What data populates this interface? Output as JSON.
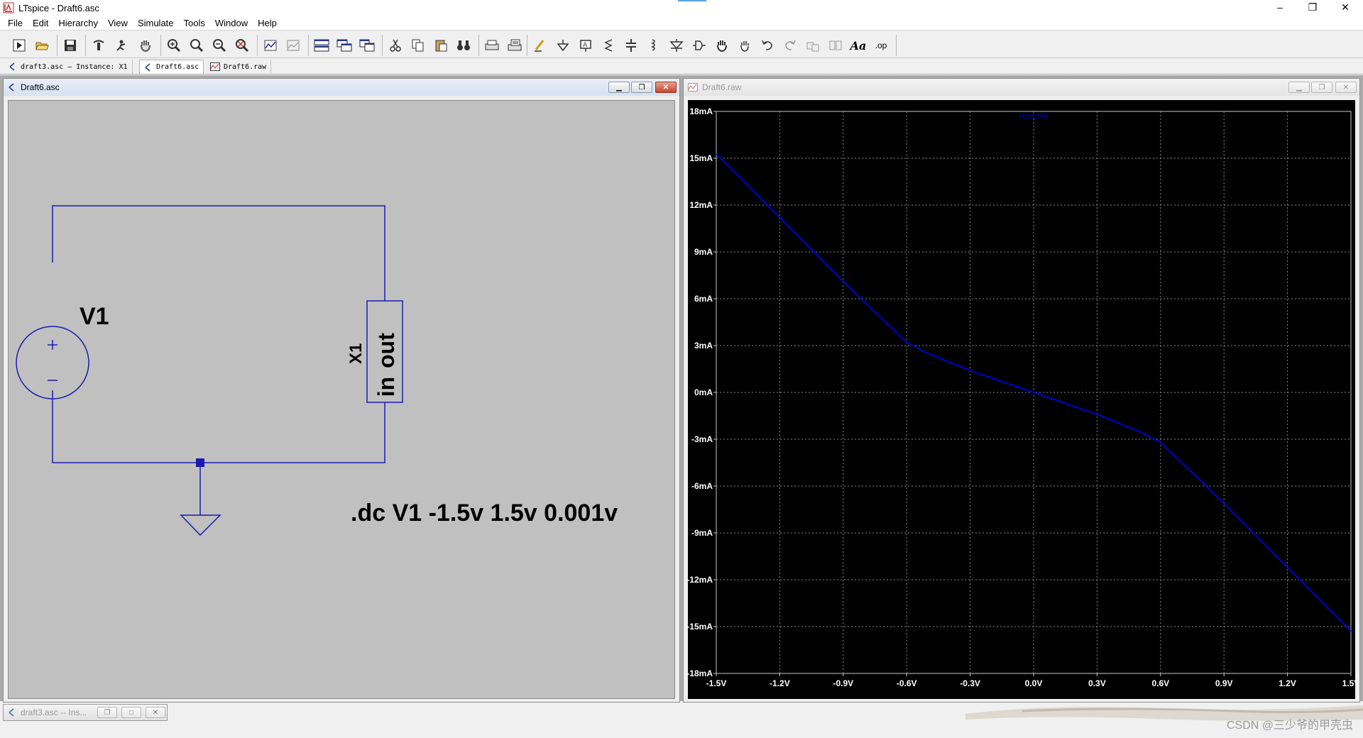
{
  "window": {
    "title": "LTspice - Draft6.asc",
    "controls": [
      "–",
      "❐",
      "✕"
    ]
  },
  "menu": [
    "File",
    "Edit",
    "Hierarchy",
    "View",
    "Simulate",
    "Tools",
    "Window",
    "Help"
  ],
  "toolbar": {
    "icons": [
      "run-icon",
      "open-folder-icon",
      "save-icon",
      "control-panel-icon",
      "halt-icon",
      "pan-hand-icon",
      "zoom-in-icon",
      "zoom-full-icon",
      "zoom-out-icon",
      "zoom-cancel-icon",
      "autorange-icon",
      "plot-settings-icon",
      "tile-horizontal-icon",
      "cascade-icon",
      "tile-vertical-icon",
      "cut-icon",
      "copy-icon",
      "paste-icon",
      "find-icon",
      "print-icon",
      "print-preview-icon",
      "wire-icon",
      "ground-icon",
      "label-net-icon",
      "resistor-icon",
      "capacitor-icon",
      "inductor-icon",
      "diode-icon",
      "component-icon",
      "move-icon",
      "drag-icon",
      "undo-icon",
      "redo-icon",
      "rotate-icon",
      "mirror-icon",
      "text-icon",
      "spice-directive-icon"
    ],
    "text_label": "Aa",
    "op_label": ".op"
  },
  "tabs": [
    {
      "label": "draft3.asc — Instance: X1",
      "kind": "schematic"
    },
    {
      "label": "Draft6.asc",
      "kind": "schematic"
    },
    {
      "label": "Draft6.raw",
      "kind": "waveform"
    }
  ],
  "schematic_window": {
    "title": "Draft6.asc",
    "source_label": "V1",
    "subckt_label": "X1",
    "pin_in": "in",
    "pin_out": "out",
    "directive": ".dc V1 -1.5v 1.5v 0.001v",
    "background": "#c0c0c0",
    "wire_color": "#1a1ab0"
  },
  "waveform_window": {
    "title": "Draft6.raw",
    "trace_label": "Ix(x1:IN)",
    "trace_color": "#0000d0"
  },
  "chart_data": {
    "type": "line",
    "title": "",
    "series": [
      {
        "name": "Ix(x1:IN)",
        "x": [
          -1.5,
          -1.2,
          -0.9,
          -0.6,
          -0.5,
          -0.3,
          0.0,
          0.3,
          0.5,
          0.6,
          0.9,
          1.2,
          1.5
        ],
        "y": [
          0.0153,
          0.0112,
          0.0071,
          0.0032,
          0.0025,
          0.0014,
          0.0,
          -0.0014,
          -0.0025,
          -0.0032,
          -0.0071,
          -0.0112,
          -0.0153
        ]
      }
    ],
    "xlim": [
      -1.5,
      1.5
    ],
    "ylim": [
      -0.018,
      0.018
    ],
    "xticks": [
      "-1.5V",
      "-1.2V",
      "-0.9V",
      "-0.6V",
      "-0.3V",
      "0.0V",
      "0.3V",
      "0.6V",
      "0.9V",
      "1.2V",
      "1.5V"
    ],
    "yticks": [
      "18mA",
      "15mA",
      "12mA",
      "9mA",
      "6mA",
      "3mA",
      "0mA",
      "-3mA",
      "-6mA",
      "-9mA",
      "-12mA",
      "-15mA",
      "-18mA"
    ],
    "grid": true,
    "background": "#000000"
  },
  "minimized_window": {
    "title": "draft3.asc -- Ins..."
  },
  "watermark": "CSDN @三少爷的甲壳虫"
}
